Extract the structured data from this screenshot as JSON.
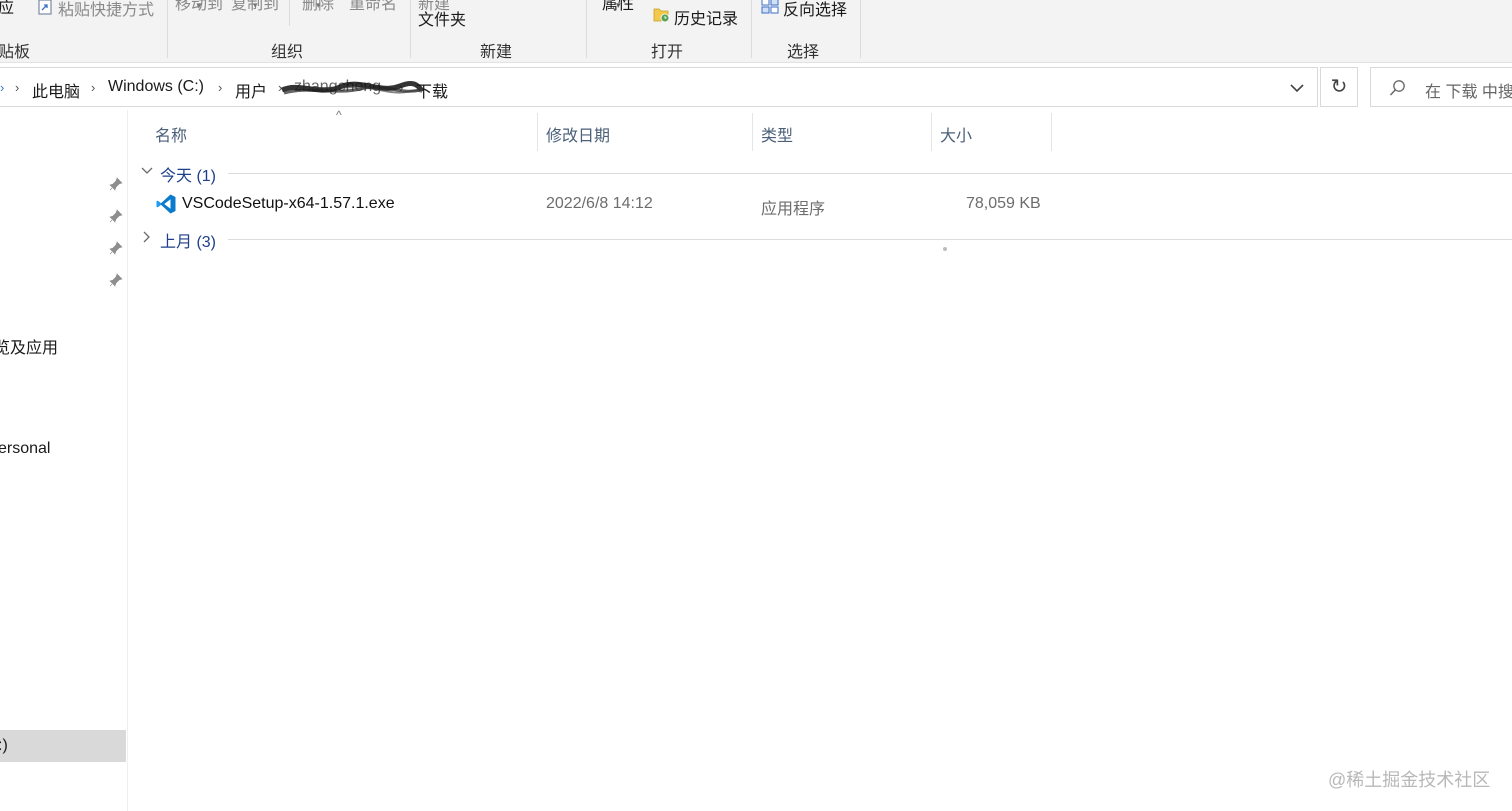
{
  "ribbon": {
    "top_row": {
      "cut_off_left": "应",
      "paste_shortcut": "粘贴快捷方式",
      "move_to": "移动到",
      "copy_to": "复制到",
      "delete": "删除",
      "rename": "重命名",
      "new_folder_top": "新建",
      "new_folder_bottom": "文件夹",
      "properties": "属性",
      "history": "历史记录",
      "invert_selection": "反向选择"
    },
    "groups": {
      "clipboard": "贴板",
      "organize": "组织",
      "new": "新建",
      "open": "打开",
      "select": "选择"
    }
  },
  "address": {
    "crumbs": [
      "此电脑",
      "Windows (C:)",
      "用户",
      "zhangcheng",
      "下载"
    ],
    "search_placeholder": "在 下载 中搜"
  },
  "nav": {
    "item_apps": "览及应用",
    "item_personal": "ersonal",
    "item_drive": ":)"
  },
  "columns": {
    "name": "名称",
    "modified": "修改日期",
    "type": "类型",
    "size": "大小"
  },
  "groups": [
    {
      "label": "今天 (1)",
      "expanded": true
    },
    {
      "label": "上月 (3)",
      "expanded": false
    }
  ],
  "files": [
    {
      "name": "VSCodeSetup-x64-1.57.1.exe",
      "modified": "2022/6/8 14:12",
      "type": "应用程序",
      "size": "78,059 KB",
      "icon": "vscode-icon",
      "icon_color": "#0a7acc"
    }
  ],
  "watermark": "@稀土掘金技术社区"
}
